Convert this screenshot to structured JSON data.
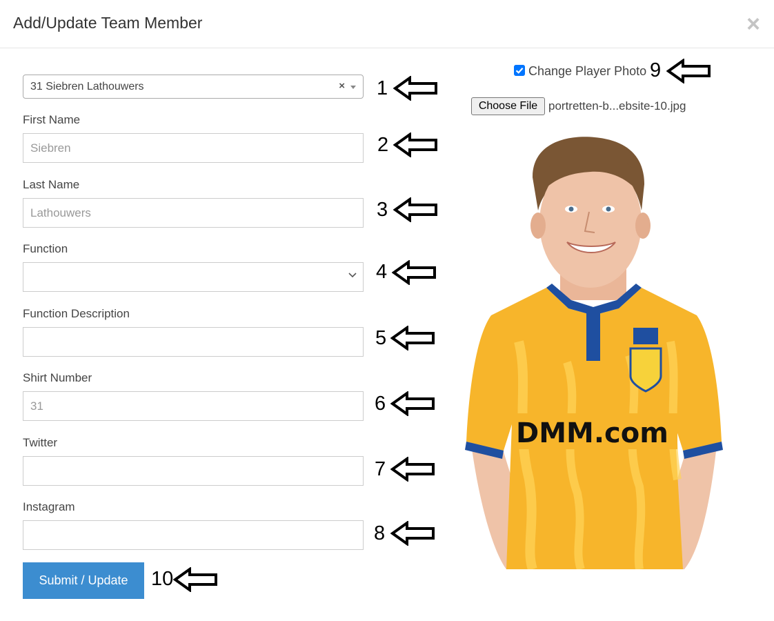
{
  "modal": {
    "title": "Add/Update Team Member",
    "close_symbol": "×"
  },
  "form": {
    "member_select": {
      "value": "31 Siebren Lathouwers",
      "clear_symbol": "×"
    },
    "first_name": {
      "label": "First Name",
      "value": "Siebren"
    },
    "last_name": {
      "label": "Last Name",
      "value": "Lathouwers"
    },
    "function": {
      "label": "Function",
      "value": ""
    },
    "function_description": {
      "label": "Function Description",
      "value": ""
    },
    "shirt_number": {
      "label": "Shirt Number",
      "value": "31"
    },
    "twitter": {
      "label": "Twitter",
      "value": ""
    },
    "instagram": {
      "label": "Instagram",
      "value": ""
    },
    "submit_label": "Submit / Update"
  },
  "photo_panel": {
    "change_photo_label": "Change Player Photo",
    "change_photo_checked": true,
    "choose_file_label": "Choose File",
    "file_name": "portretten-b...ebsite-10.jpg"
  },
  "annotations": {
    "n1": "1",
    "n2": "2",
    "n3": "3",
    "n4": "4",
    "n5": "5",
    "n6": "6",
    "n7": "7",
    "n8": "8",
    "n9": "9",
    "n10": "10"
  },
  "colors": {
    "primary_button": "#3c8dd0",
    "checkbox": "#0075ff",
    "jersey": "#f7b52b",
    "jersey_trim": "#1f4fa0"
  },
  "icons": {
    "close": "close-icon",
    "select_arrow": "caret-down-icon",
    "dropdown_chevron": "chevron-down-icon",
    "annotation_arrow": "left-arrow-icon"
  }
}
